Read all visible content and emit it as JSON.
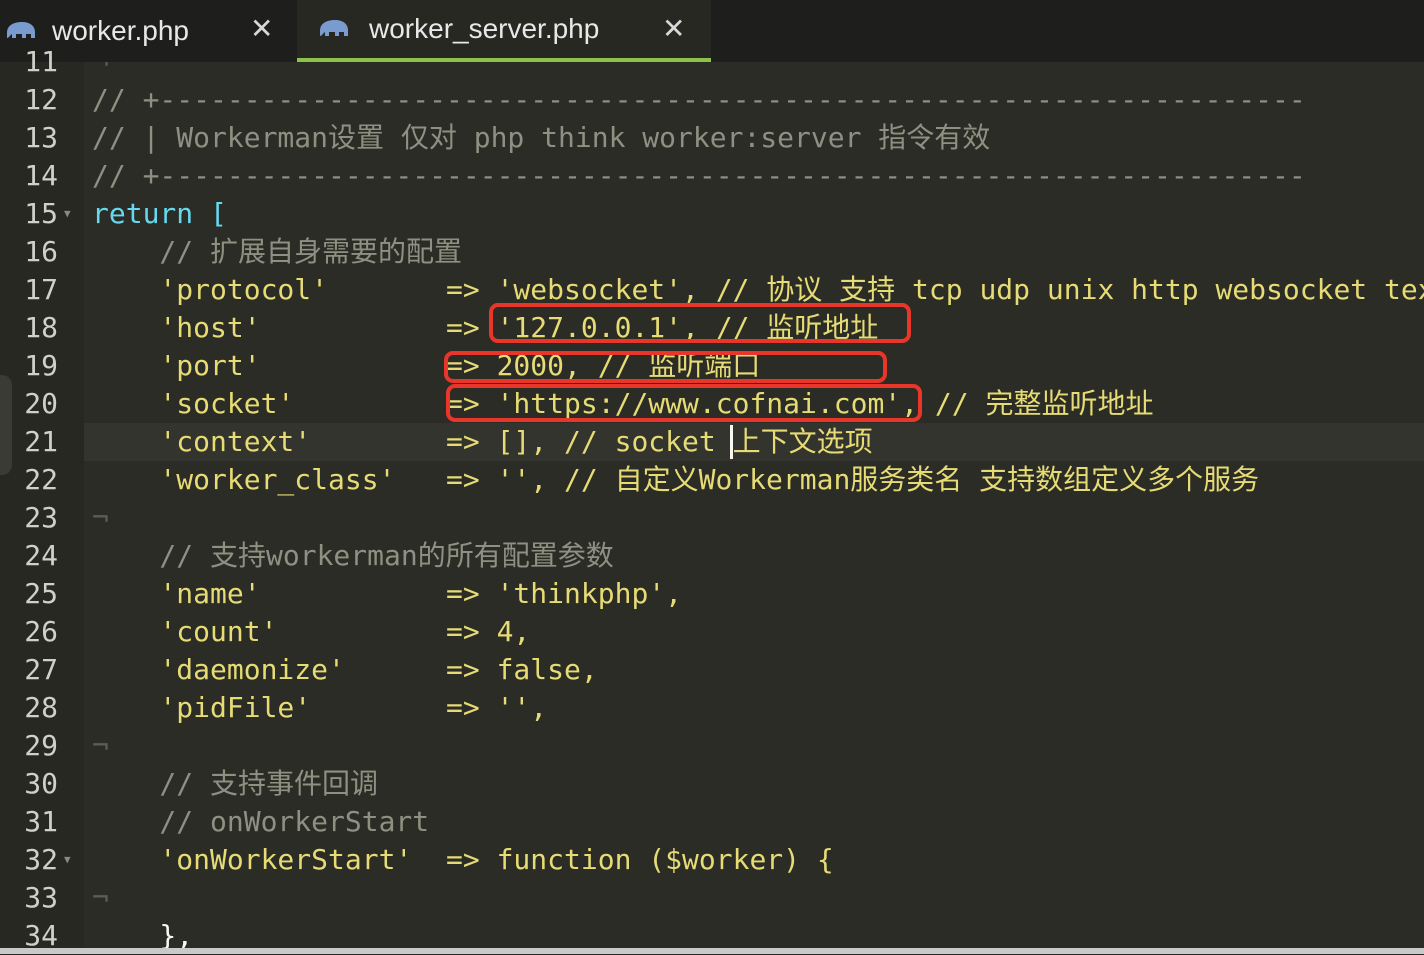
{
  "tabs": [
    {
      "label": "worker.php",
      "active": false
    },
    {
      "label": "worker_server.php",
      "active": true
    }
  ],
  "editor": {
    "lines": [
      {
        "n": "11",
        "code": ""
      },
      {
        "n": "12",
        "code": "// +--------------------------------------------------------------------"
      },
      {
        "n": "13",
        "code": "// | Workerman设置 仅对 php think worker:server 指令有效"
      },
      {
        "n": "14",
        "code": "// +--------------------------------------------------------------------"
      },
      {
        "n": "15",
        "code": "return ["
      },
      {
        "n": "16",
        "code": "    // 扩展自身需要的配置"
      },
      {
        "n": "17",
        "code": "    'protocol'       => 'websocket', // 协议 支持 tcp udp unix http websocket text"
      },
      {
        "n": "18",
        "code": "    'host'           => '127.0.0.1', // 监听地址"
      },
      {
        "n": "19",
        "code": "    'port'           => 2000, // 监听端口"
      },
      {
        "n": "20",
        "code": "    'socket'         => 'https://www.cofnai.com', // 完整监听地址"
      },
      {
        "n": "21",
        "code": "    'context'        => [], // socket 上下文选项"
      },
      {
        "n": "22",
        "code": "    'worker_class'   => '', // 自定义Workerman服务类名 支持数组定义多个服务"
      },
      {
        "n": "23",
        "code": ""
      },
      {
        "n": "24",
        "code": "    // 支持workerman的所有配置参数"
      },
      {
        "n": "25",
        "code": "    'name'           => 'thinkphp',"
      },
      {
        "n": "26",
        "code": "    'count'          => 4,"
      },
      {
        "n": "27",
        "code": "    'daemonize'      => false,"
      },
      {
        "n": "28",
        "code": "    'pidFile'        => '',"
      },
      {
        "n": "29",
        "code": ""
      },
      {
        "n": "30",
        "code": "    // 支持事件回调"
      },
      {
        "n": "31",
        "code": "    // onWorkerStart"
      },
      {
        "n": "32",
        "code": "    'onWorkerStart'  => function ($worker) {"
      },
      {
        "n": "33",
        "code": ""
      },
      {
        "n": "34",
        "code": "    },"
      }
    ]
  },
  "colors": {
    "background": "#272822",
    "comment": "#8f9082",
    "string": "#e6db74",
    "keyword": "#66d9ef",
    "operator": "#f92672",
    "number": "#ae81ff",
    "highlight_box": "#e8362a",
    "active_tab_underline": "#8bc34a"
  },
  "icons": {
    "tab_icon": "php-elephant-icon",
    "tab_close": "close-icon",
    "fold_marker": "fold-arrow-icon"
  }
}
